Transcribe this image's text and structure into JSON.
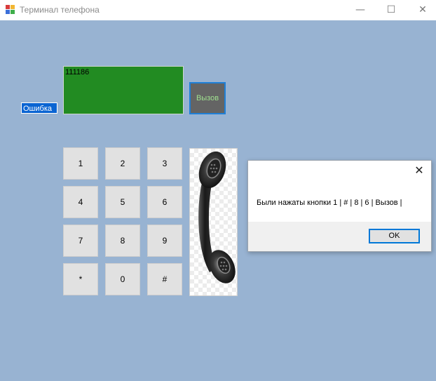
{
  "window": {
    "title": "Терминал телефона",
    "controls": {
      "minimize": "—",
      "maximize": "☐",
      "close": "✕"
    },
    "icon": "app-window-icon"
  },
  "status_label": "Ошибка",
  "display": {
    "value": "111186"
  },
  "call_button": {
    "label": "Вызов"
  },
  "keypad": {
    "k1": "1",
    "k2": "2",
    "k3": "3",
    "k4": "4",
    "k5": "5",
    "k6": "6",
    "k7": "7",
    "k8": "8",
    "k9": "9",
    "kstar": "*",
    "k0": "0",
    "khash": "#"
  },
  "phone_image": {
    "icon": "telephone-handset-icon"
  },
  "message_box": {
    "close": "✕",
    "message": "Были нажаты кнопки 1 | # | 8 | 6 | Вызов |",
    "ok_label": "OK"
  },
  "colors": {
    "client_bg": "#98b3d2",
    "display_bg": "#228b22",
    "call_button_bg": "#646464",
    "call_button_text": "#9fe08f",
    "status_label_bg": "#0a64d2"
  }
}
